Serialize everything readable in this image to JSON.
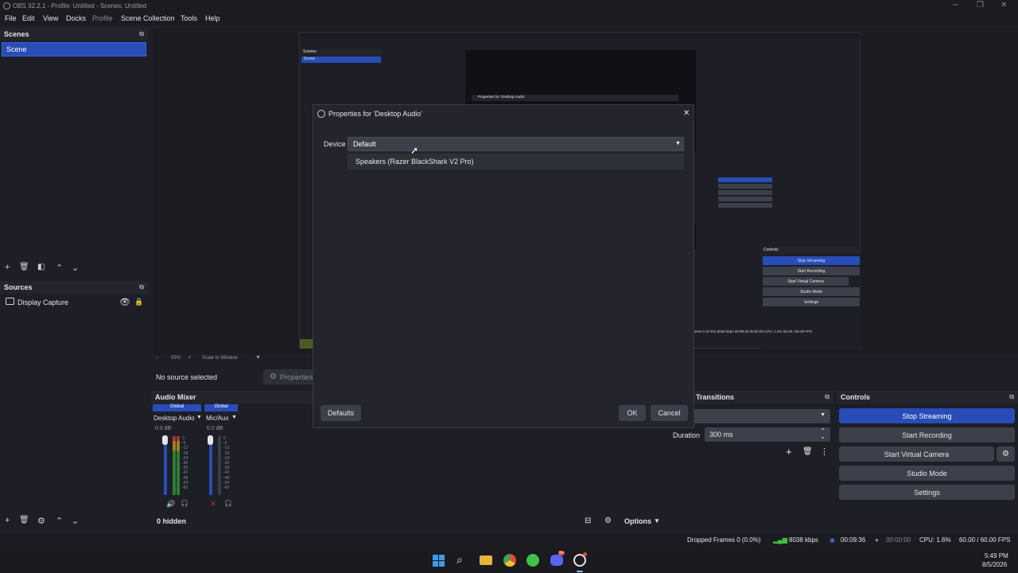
{
  "window": {
    "title": "OBS 32.2.1 - Profile: Untitled - Scenes: Untitled"
  },
  "menu": [
    "File",
    "Edit",
    "View",
    "Docks",
    "Profile",
    "Scene Collection",
    "Tools",
    "Help"
  ],
  "scenes": {
    "header": "Scenes",
    "items": [
      "Scene"
    ]
  },
  "sources": {
    "header": "Sources",
    "items": [
      "Display Capture"
    ]
  },
  "source_bar": {
    "no_selection": "No source selected",
    "properties": "Properties"
  },
  "audio_mixer": {
    "header": "Audio Mixer",
    "channels": [
      {
        "badge": "Global",
        "name": "Desktop Audio",
        "db": "0.0 dB"
      },
      {
        "badge": "Global",
        "name": "Mic/Aux",
        "db": "0.0 dB"
      }
    ],
    "scale": [
      "0",
      "-6",
      "-12",
      "-18",
      "-24",
      "-30",
      "-36",
      "-42",
      "-48",
      "-54",
      "-60"
    ],
    "hidden": "0 hidden",
    "options": "Options"
  },
  "transitions": {
    "header": "Transitions",
    "duration_label": "Duration",
    "duration_value": "300 ms"
  },
  "controls": {
    "header": "Controls",
    "stop_streaming": "Stop Streaming",
    "start_recording": "Start Recording",
    "start_virtual_camera": "Start Virtual Camera",
    "studio_mode": "Studio Mode",
    "settings": "Settings"
  },
  "dialog": {
    "title": "Properties for 'Desktop Audio'",
    "device_label": "Device",
    "device_value": "Default",
    "dropdown_option": "Speakers (Razer BlackShark V2 Pro)",
    "defaults": "Defaults",
    "ok": "OK",
    "cancel": "Cancel"
  },
  "preview_inner": {
    "scenes": "Scenes",
    "scene": "Scene",
    "properties_title": "Properties for 'Desktop Audio'",
    "zoom": "55%",
    "scale": "Scale to Window",
    "controls": "Controls",
    "stop_streaming": "Stop Streaming",
    "start_recording": "Start Recording",
    "start_virtual_camera": "Start Virtual Camera",
    "studio_mode": "Studio Mode",
    "settings": "Settings",
    "status": "Frames 0 (0.0%)   8038 kbps   00:09:36   00:00:00   CPU: 1.6%   60.00 / 60.00 FPS"
  },
  "status": {
    "dropped": "Dropped Frames 0 (0.0%)",
    "kbps": "8038 kbps",
    "stream_time": "00:09:36",
    "rec_time": "00:00:00",
    "cpu": "CPU: 1.6%",
    "fps": "60.00 / 60.00 FPS"
  },
  "taskbar": {
    "time": "5:49 PM",
    "date": "8/5/2026",
    "discord_badge": "9+"
  },
  "colors": {
    "accent": "#284cb8",
    "bg": "#1e1f26",
    "panel": "#24252c"
  }
}
